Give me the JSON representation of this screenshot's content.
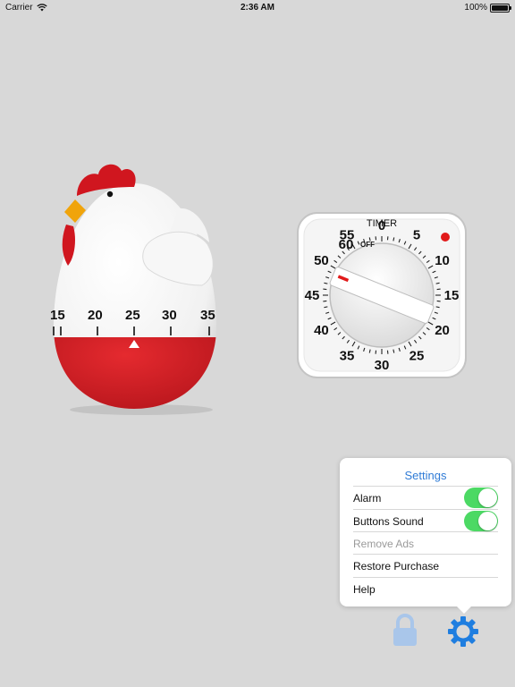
{
  "status_bar": {
    "carrier": "Carrier",
    "time": "2:36 AM",
    "battery": "100%"
  },
  "chicken_timer": {
    "scale_labels": [
      "15",
      "20",
      "25",
      "30",
      "35"
    ]
  },
  "dial_timer": {
    "title": "TIMER",
    "off_label": "OFF",
    "numbers": [
      "0",
      "5",
      "10",
      "15",
      "20",
      "25",
      "30",
      "35",
      "40",
      "45",
      "50",
      "55",
      "60"
    ]
  },
  "settings": {
    "title": "Settings",
    "items": [
      {
        "label": "Alarm",
        "toggle": true,
        "disabled": false
      },
      {
        "label": "Buttons Sound",
        "toggle": true,
        "disabled": false
      },
      {
        "label": "Remove Ads",
        "toggle": false,
        "disabled": true
      },
      {
        "label": "Restore Purchase",
        "toggle": false,
        "disabled": false
      },
      {
        "label": "Help",
        "toggle": false,
        "disabled": false
      }
    ]
  },
  "bottom_icons": [
    "lock-icon",
    "gear-icon"
  ],
  "colors": {
    "accent": "#2f7bd6",
    "toggle_on": "#4cd964",
    "chicken_red": "#d0161f"
  }
}
